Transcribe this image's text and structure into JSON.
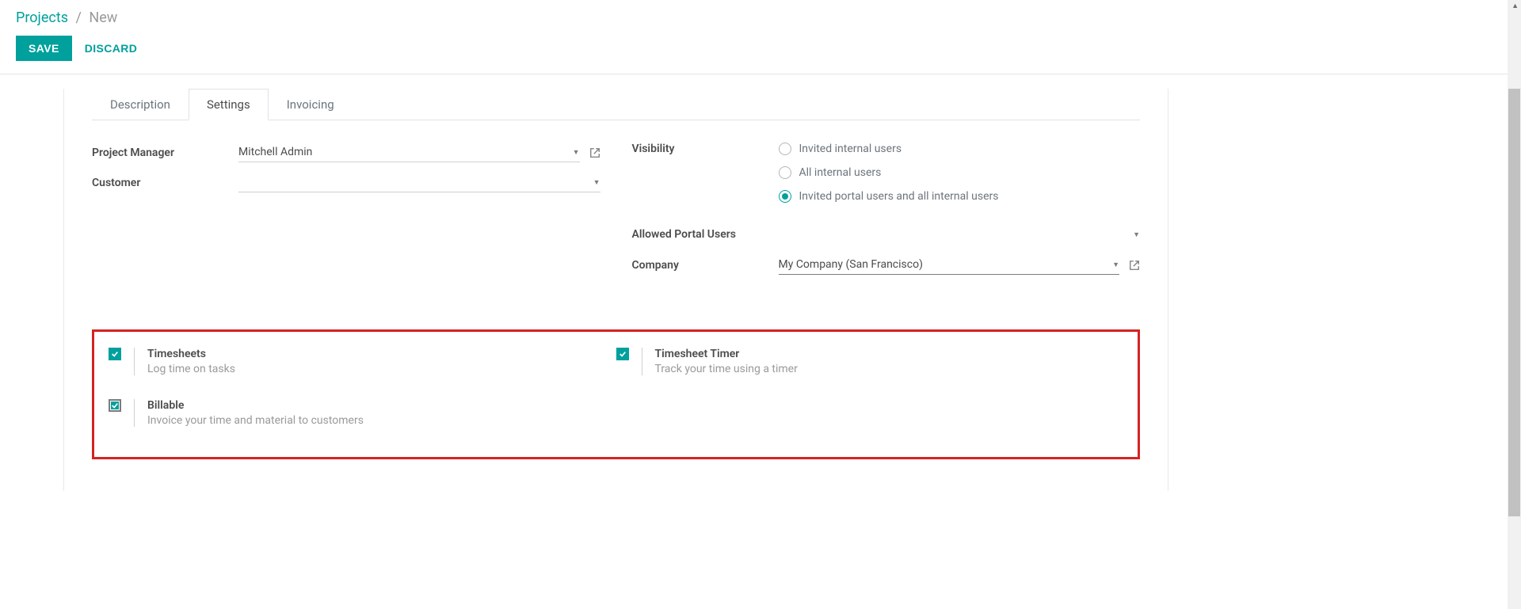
{
  "breadcrumb": {
    "root": "Projects",
    "current": "New"
  },
  "actions": {
    "save": "SAVE",
    "discard": "DISCARD"
  },
  "tabs": {
    "description": "Description",
    "settings": "Settings",
    "invoicing": "Invoicing"
  },
  "form": {
    "left": {
      "project_manager_label": "Project Manager",
      "project_manager_value": "Mitchell Admin",
      "customer_label": "Customer",
      "customer_value": ""
    },
    "right": {
      "visibility_label": "Visibility",
      "visibility_options": {
        "o1": "Invited internal users",
        "o2": "All internal users",
        "o3": "Invited portal users and all internal users"
      },
      "allowed_portal_label": "Allowed Portal Users",
      "allowed_portal_value": "",
      "company_label": "Company",
      "company_value": "My Company (San Francisco)"
    }
  },
  "options": {
    "timesheets": {
      "title": "Timesheets",
      "desc": "Log time on tasks"
    },
    "timesheet_timer": {
      "title": "Timesheet Timer",
      "desc": "Track your time using a timer"
    },
    "billable": {
      "title": "Billable",
      "desc": "Invoice your time and material to customers"
    }
  }
}
